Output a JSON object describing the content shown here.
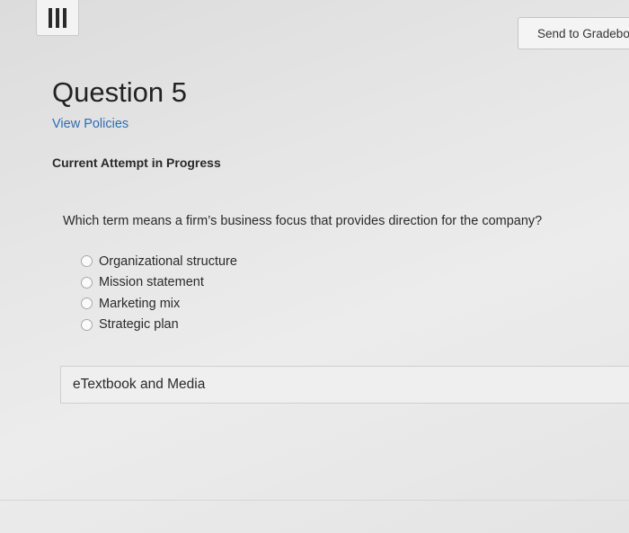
{
  "header": {
    "menu_icon": "hamburger-menu-icon",
    "gradebook_label": "Send to Gradebook"
  },
  "question": {
    "title": "Question 5",
    "policies_link": "View Policies",
    "attempt_status": "Current Attempt in Progress",
    "prompt": "Which term means a firm’s business focus that provides direction for the company?",
    "options": [
      "Organizational structure",
      "Mission statement",
      "Marketing mix",
      "Strategic plan"
    ]
  },
  "resources": {
    "etextbook_label": "eTextbook and Media"
  }
}
